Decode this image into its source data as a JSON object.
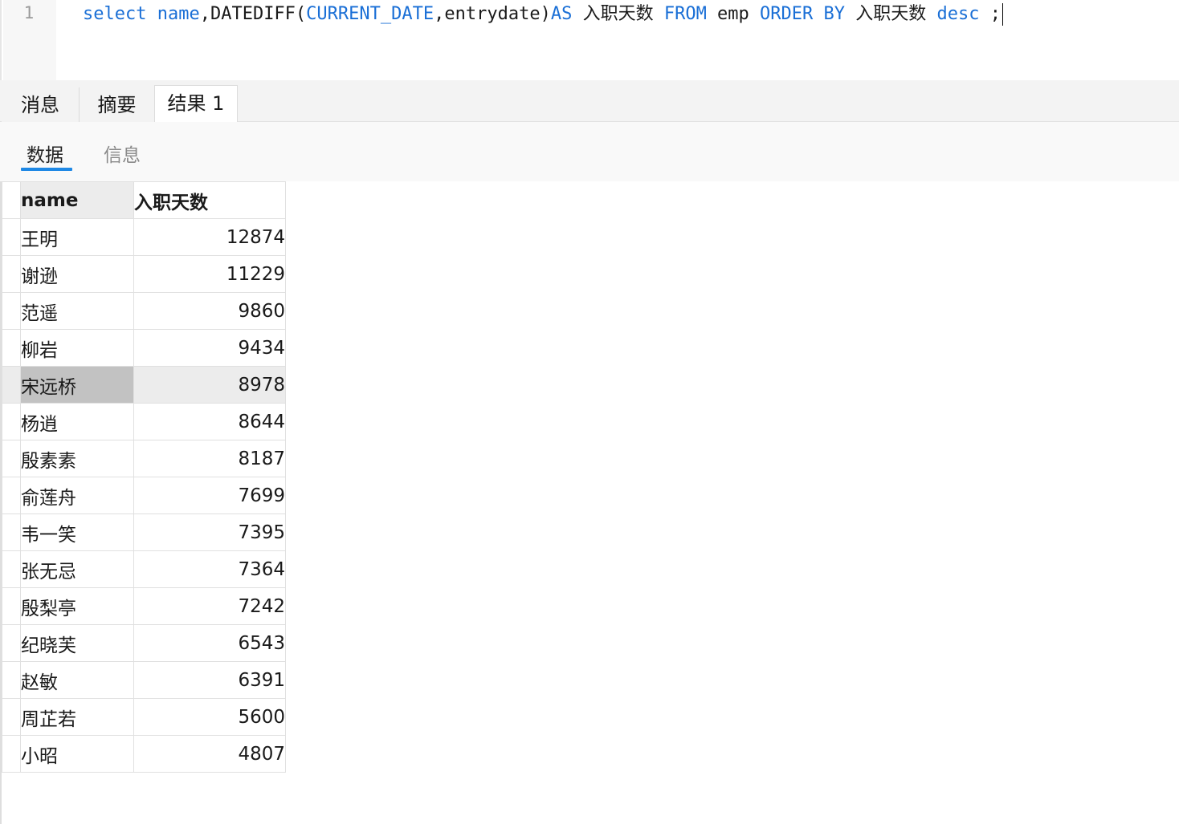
{
  "editor": {
    "line_number": "1",
    "tokens": [
      {
        "text": "select",
        "kind": "kw"
      },
      {
        "text": " ",
        "kind": "plain"
      },
      {
        "text": "name",
        "kind": "kw"
      },
      {
        "text": ",DATEDIFF(",
        "kind": "plain"
      },
      {
        "text": "CURRENT_DATE",
        "kind": "kw"
      },
      {
        "text": ",entrydate)",
        "kind": "plain"
      },
      {
        "text": "AS",
        "kind": "kw"
      },
      {
        "text": " 入职天数 ",
        "kind": "plain"
      },
      {
        "text": "FROM",
        "kind": "kw"
      },
      {
        "text": " emp ",
        "kind": "plain"
      },
      {
        "text": "ORDER BY",
        "kind": "kw"
      },
      {
        "text": " 入职天数 ",
        "kind": "plain"
      },
      {
        "text": "desc",
        "kind": "kw"
      },
      {
        "text": " ;",
        "kind": "plain"
      }
    ]
  },
  "result_tabs": [
    {
      "label": "消息",
      "active": false
    },
    {
      "label": "摘要",
      "active": false
    },
    {
      "label": "结果 1",
      "active": true
    }
  ],
  "sub_tabs": [
    {
      "label": "数据",
      "active": true
    },
    {
      "label": "信息",
      "active": false
    }
  ],
  "grid": {
    "columns": [
      "name",
      "入职天数"
    ],
    "selected_row": 4,
    "rows": [
      {
        "name": "王明",
        "days": "12874"
      },
      {
        "name": "谢逊",
        "days": "11229"
      },
      {
        "name": "范遥",
        "days": "9860"
      },
      {
        "name": "柳岩",
        "days": "9434"
      },
      {
        "name": "宋远桥",
        "days": "8978"
      },
      {
        "name": "杨逍",
        "days": "8644"
      },
      {
        "name": "殷素素",
        "days": "8187"
      },
      {
        "name": "俞莲舟",
        "days": "7699"
      },
      {
        "name": "韦一笑",
        "days": "7395"
      },
      {
        "name": "张无忌",
        "days": "7364"
      },
      {
        "name": "殷梨亭",
        "days": "7242"
      },
      {
        "name": "纪晓芙",
        "days": "6543"
      },
      {
        "name": "赵敏",
        "days": "6391"
      },
      {
        "name": "周芷若",
        "days": "5600"
      },
      {
        "name": "小昭",
        "days": "4807"
      }
    ]
  },
  "colors": {
    "keyword": "#1a6fd6",
    "accent": "#1e88e5",
    "selection": "#c2c2c2"
  }
}
